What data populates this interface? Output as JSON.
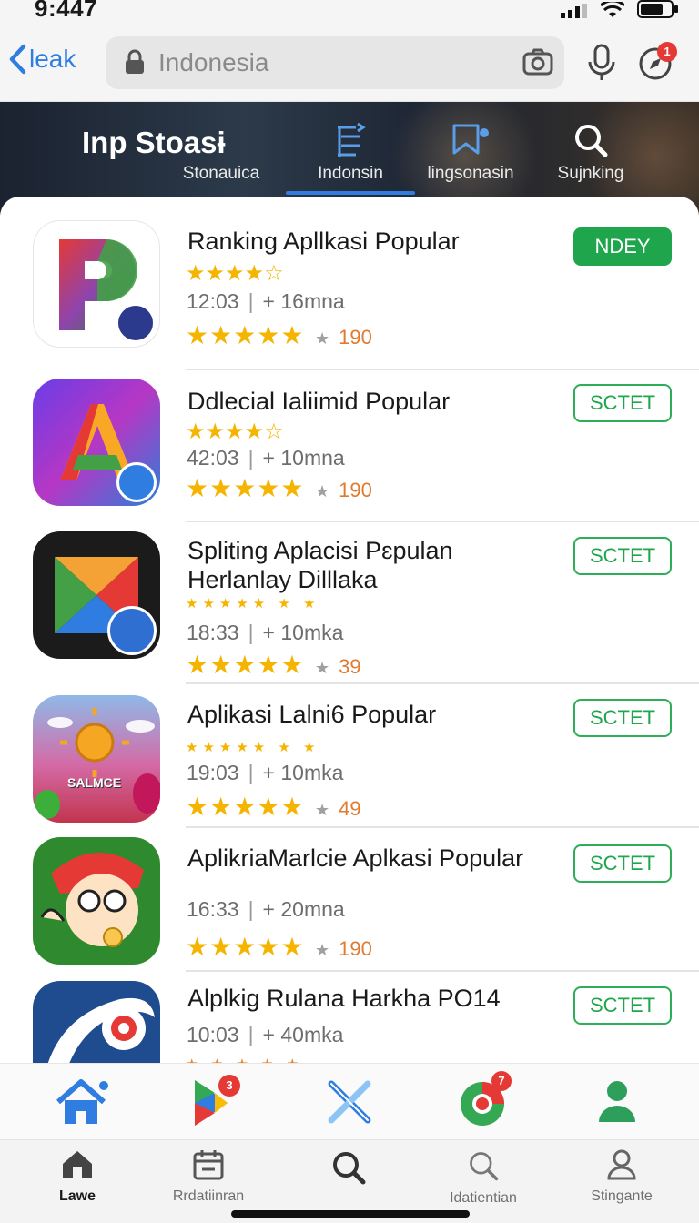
{
  "status": {
    "time": "9:447"
  },
  "topbar": {
    "back_label": "leak",
    "search_placeholder": "Indonesia",
    "notification_count": "1"
  },
  "header": {
    "title": "Inp Stoasɨ",
    "tabs": [
      {
        "label": "Stonauica",
        "icon": "none"
      },
      {
        "label": "Indonsin",
        "icon": "list-icon",
        "active": true
      },
      {
        "label": "lingsonasin",
        "icon": "bookmark-icon"
      },
      {
        "label": "Sujnking",
        "icon": "search-icon"
      }
    ]
  },
  "apps": [
    {
      "name": "Ranking Apllkasi Popular",
      "name2": "",
      "meta_time": "12:03",
      "meta_size": "+ 16mna",
      "rating_small": "★★★★☆",
      "rating_big": "★★★★★",
      "count": "190",
      "button": "NDEY",
      "button_style": "filled",
      "icon": "p-logo-icon"
    },
    {
      "name": "Ddlecial Ialiimid Popular",
      "name2": "",
      "meta_time": "42:03",
      "meta_size": "+ 10mna",
      "rating_small": "★★★★☆",
      "rating_big": "★★★★★",
      "count": "190",
      "button": "SCTET",
      "button_style": "outline",
      "icon": "a-logo-icon"
    },
    {
      "name": "Spliting Aplacisi Pɛpulan",
      "name2": "Herlanlay Dilllaka",
      "meta_time": "18:33",
      "meta_size": "+ 10mka",
      "rating_small": "★★★★★ ★ ★",
      "rating_big": "★★★★★",
      "count": "39",
      "button": "SCTET",
      "button_style": "outline",
      "icon": "prism-logo-icon"
    },
    {
      "name": "Aplikasi Lalni6 Popular",
      "name2": "",
      "meta_time": "19:03",
      "meta_size": "+ 10mka",
      "rating_small": "★★★★★ ★ ★",
      "rating_big": "★★★★★",
      "count": "49",
      "button": "SCTET",
      "button_style": "outline",
      "icon": "game-art-icon",
      "icon_caption": "SALMCE"
    },
    {
      "name": "AplikriaMarlcie Aplkasi Popular",
      "name2": "",
      "meta_time": "16:33",
      "meta_size": "+ 20mna",
      "rating_small": "",
      "rating_big": "★★★★★",
      "count": "190",
      "button": "SCTET",
      "button_style": "outline",
      "icon": "character-art-icon"
    },
    {
      "name": "Alplkig Rulana Harkha PO14",
      "name2": "",
      "meta_time": "10:03",
      "meta_size": "+ 40mka",
      "rating_small": "★ ★ ★ ★ ★",
      "rating_big": "",
      "count": "",
      "button": "SCTET",
      "button_style": "outline",
      "icon": "swoosh-logo-icon"
    }
  ],
  "nav_top": {
    "play_badge": "3",
    "chrome_badge": "7"
  },
  "nav_bottom": [
    {
      "label": "Lawe",
      "icon": "house-icon",
      "active": true
    },
    {
      "label": "Rrdatiinran",
      "icon": "calendar-icon"
    },
    {
      "label": "",
      "icon": "search-icon"
    },
    {
      "label": "Idatientian",
      "icon": "search-icon"
    },
    {
      "label": "Stingante",
      "icon": "person-icon"
    }
  ],
  "colors": {
    "accent": "#2f7de1",
    "install_green": "#1fa64d",
    "star": "#f5b400",
    "count_orange": "#e07a2e"
  }
}
